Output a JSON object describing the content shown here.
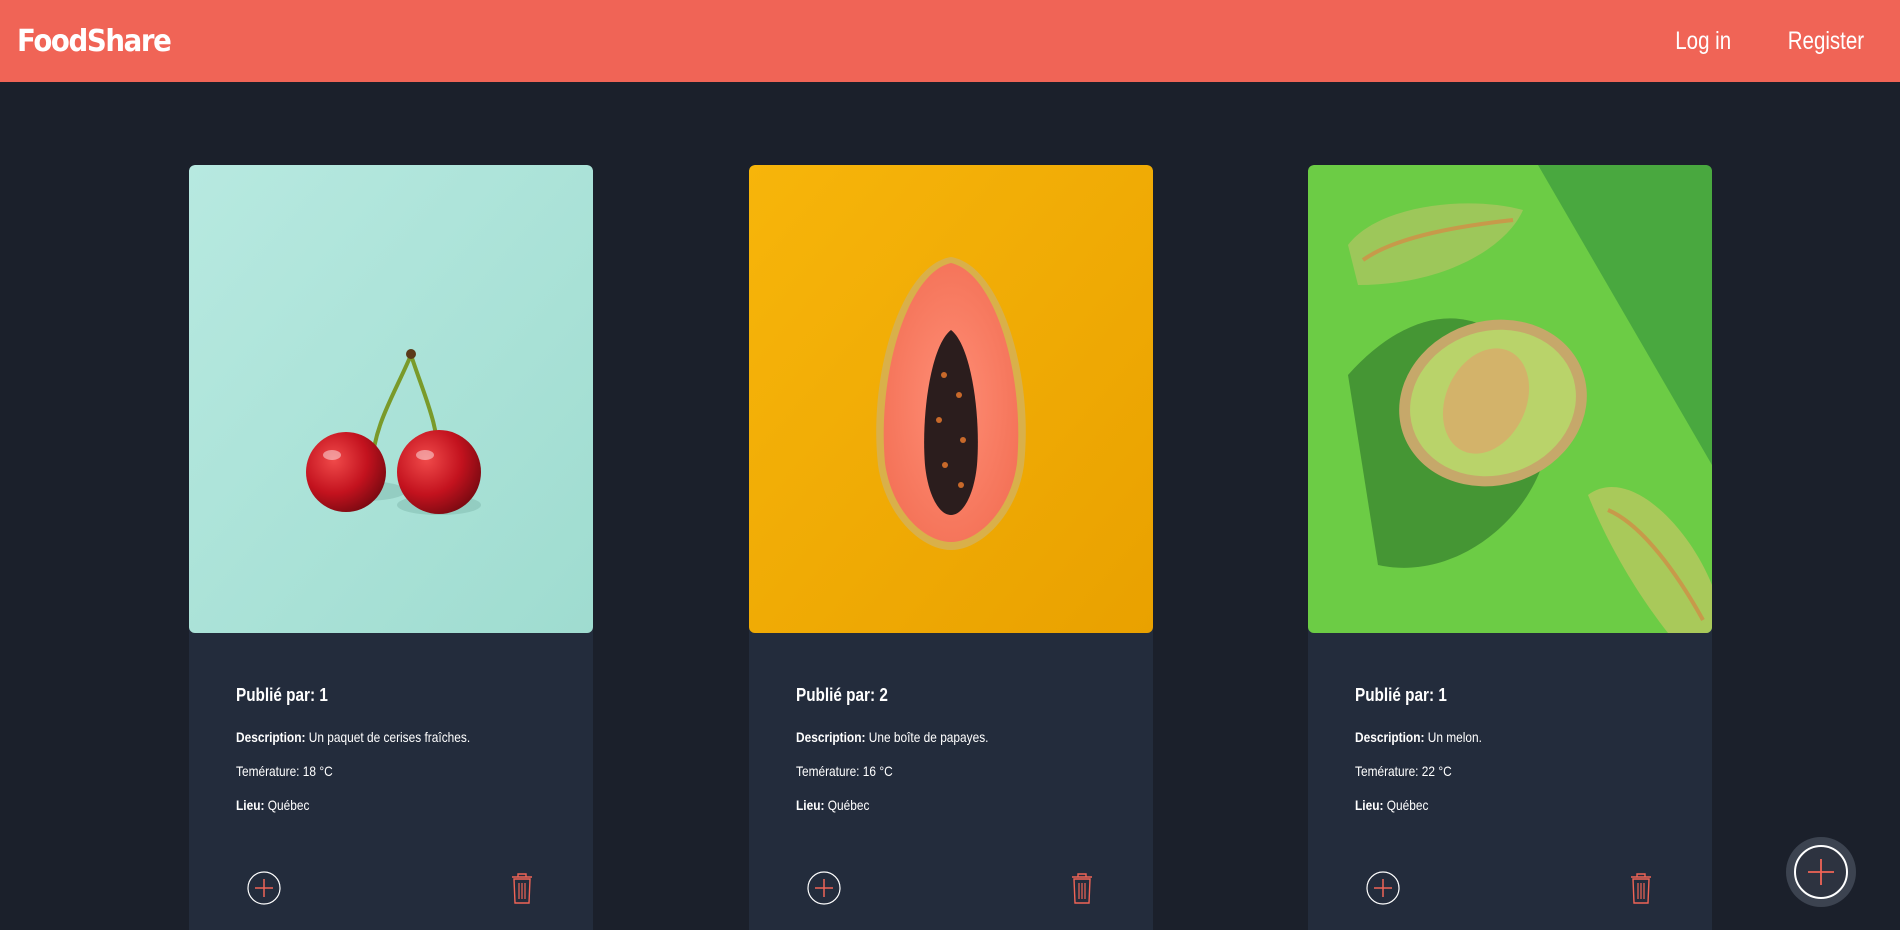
{
  "navbar": {
    "brand": "FoodShare",
    "login_label": "Log in",
    "register_label": "Register"
  },
  "colors": {
    "header_bg": "#f06456",
    "page_bg": "#1b202b",
    "card_bg": "#232c3c",
    "accent_icon": "#f06456"
  },
  "cards": [
    {
      "image": "cherries-photo",
      "title": "Publié par: 1",
      "description_label": "Description:",
      "description": "Un paquet de cerises fraîches.",
      "temperature": "Temérature: 18 °C",
      "location_label": "Lieu:",
      "location": "Québec"
    },
    {
      "image": "papaya-photo",
      "title": "Publié par: 2",
      "description_label": "Description:",
      "description": "Une boîte de papayes.",
      "temperature": "Temérature: 16 °C",
      "location_label": "Lieu:",
      "location": "Québec"
    },
    {
      "image": "melon-photo",
      "title": "Publié par: 1",
      "description_label": "Description:",
      "description": "Un melon.",
      "temperature": "Temérature: 22 °C",
      "location_label": "Lieu:",
      "location": "Québec"
    }
  ],
  "icons": {
    "add": "plus-circle-icon",
    "delete": "trash-icon",
    "fab": "plus-icon"
  }
}
